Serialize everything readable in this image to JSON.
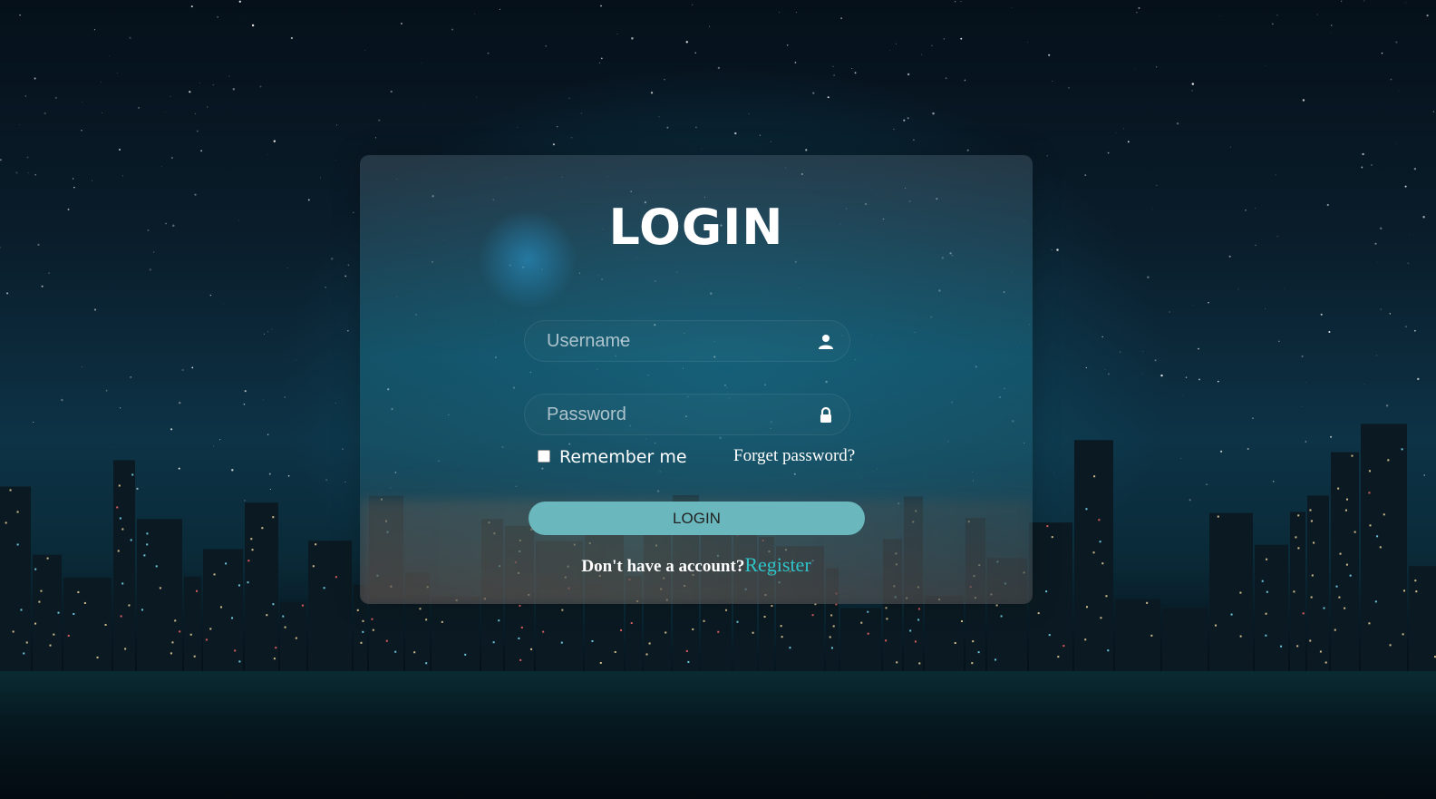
{
  "login_card": {
    "title": "LOGIN",
    "username": {
      "placeholder": "Username",
      "value": "",
      "icon": "user-icon"
    },
    "password": {
      "placeholder": "Password",
      "value": "",
      "icon": "lock-icon"
    },
    "remember_label": "Remember me",
    "remember_checked": false,
    "forgot_label": "Forget password?",
    "login_button_label": "LOGIN",
    "no_account_text": "Don't have a account?",
    "register_label": "Register"
  },
  "colors": {
    "button_bg": "#6ab8bd",
    "register_link": "#2fc4c9"
  }
}
